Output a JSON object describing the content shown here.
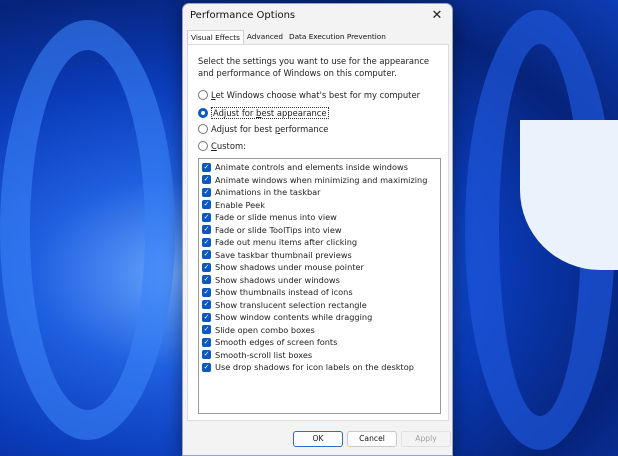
{
  "dialog": {
    "title": "Performance Options",
    "close": "✕"
  },
  "tabs": [
    "Visual Effects",
    "Advanced",
    "Data Execution Prevention"
  ],
  "description": "Select the settings you want to use for the appearance and performance of Windows on this computer.",
  "radios": [
    {
      "pre": "",
      "u": "L",
      "post": "et Windows choose what's best for my computer",
      "selected": false
    },
    {
      "pre": "Adjust for ",
      "u": "b",
      "post": "est appearance",
      "selected": true
    },
    {
      "pre": "Adjust for best ",
      "u": "p",
      "post": "erformance",
      "selected": false
    },
    {
      "pre": "",
      "u": "C",
      "post": "ustom:",
      "selected": false
    }
  ],
  "effects": [
    "Animate controls and elements inside windows",
    "Animate windows when minimizing and maximizing",
    "Animations in the taskbar",
    "Enable Peek",
    "Fade or slide menus into view",
    "Fade or slide ToolTips into view",
    "Fade out menu items after clicking",
    "Save taskbar thumbnail previews",
    "Show shadows under mouse pointer",
    "Show shadows under windows",
    "Show thumbnails instead of icons",
    "Show translucent selection rectangle",
    "Show window contents while dragging",
    "Slide open combo boxes",
    "Smooth edges of screen fonts",
    "Smooth-scroll list boxes",
    "Use drop shadows for icon labels on the desktop"
  ],
  "checkmark": "✓",
  "buttons": {
    "ok": "OK",
    "cancel": "Cancel",
    "apply": "Apply"
  }
}
